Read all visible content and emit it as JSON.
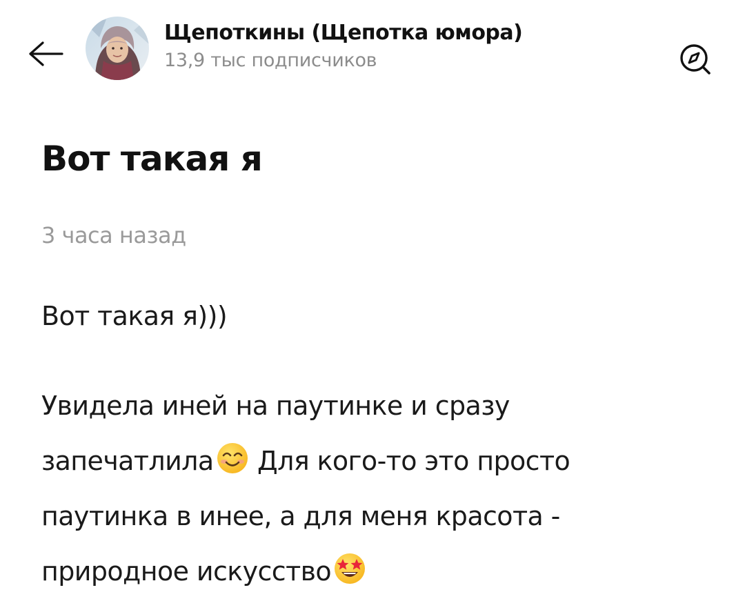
{
  "header": {
    "channel_name": "Щепоткины (Щепотка юмора)",
    "subscribers": "13,9 тыс подписчиков",
    "icons": {
      "back": "arrow-left-icon",
      "compass": "compass-icon",
      "avatar": "channel-avatar"
    }
  },
  "post": {
    "title": "Вот такая я",
    "timestamp": "3 часа назад",
    "paragraph1": "Вот такая я)))",
    "paragraph2": {
      "line1": "Увидела иней на паутинке и сразу",
      "line2_a": "запечатлила",
      "line2_emoji": "smiling-face-icon",
      "line2_b": " Для кого-то это просто",
      "line3": "паутинка в инее, а для меня красота -",
      "line4_a": "природное искусство",
      "line4_emoji": "star-struck-icon"
    }
  },
  "colors": {
    "text": "#111111",
    "muted": "#8c8c8c",
    "timestamp": "#9a9a9a",
    "background": "#ffffff"
  }
}
